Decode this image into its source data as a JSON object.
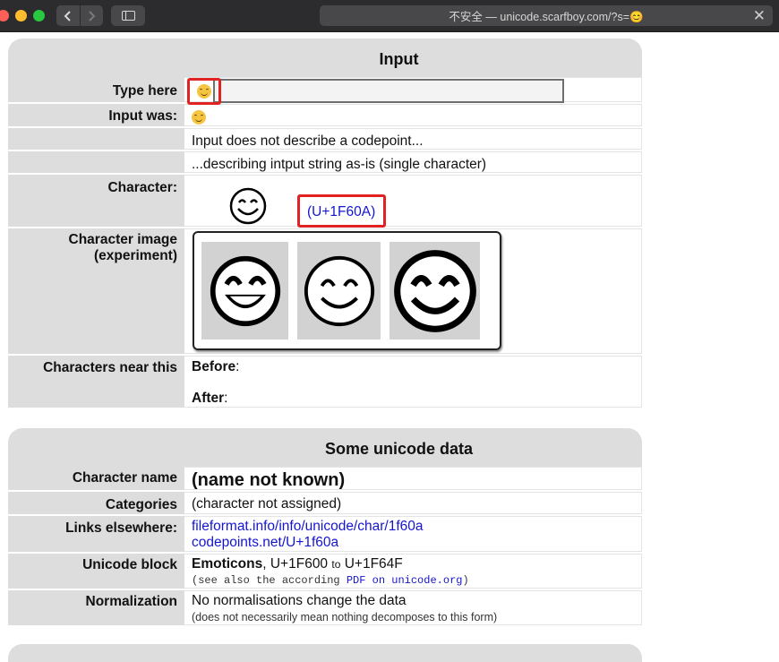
{
  "browser": {
    "address": "不安全 — unicode.scarfboy.com/?s=😊",
    "back_icon": "chevron-left-icon",
    "forward_icon": "chevron-right-icon"
  },
  "input_section": {
    "title": "Input",
    "type_here_label": "Type here",
    "typed_value": "😊",
    "input_was_label": "Input was:",
    "input_was_value": "😊",
    "note1": "Input does not describe a codepoint...",
    "note2": "...describing intput string as-is (single character)",
    "character_label": "Character:",
    "codepoint_link": "(U+1F60A)",
    "char_image_label": "Character image (experiment)",
    "near_label": "Characters near this",
    "before_label": "Before",
    "after_label": "After"
  },
  "data_section": {
    "title": "Some unicode data",
    "name_label": "Character name",
    "name_value": "(name not known)",
    "categories_label": "Categories",
    "categories_value": "(character not assigned)",
    "links_label": "Links elsewhere:",
    "link1": "fileformat.info/info/unicode/char/1f60a",
    "link2": "codepoints.net/U+1f60a",
    "block_label": "Unicode block",
    "block_name": "Emoticons",
    "block_start": "U+1F600",
    "block_to": "to",
    "block_end": "U+1F64F",
    "block_note_prefix": "(see also the according",
    "block_note_link": "PDF on unicode.org",
    "block_note_suffix": ")",
    "normalization_label": "Normalization",
    "normalization_value": "No normalisations change the data",
    "normalization_note": "(does not necessarily mean nothing decomposes to this form)"
  },
  "colors": {
    "highlight": "#e02222",
    "link": "#1515d0",
    "label_bg": "#dddddd"
  }
}
